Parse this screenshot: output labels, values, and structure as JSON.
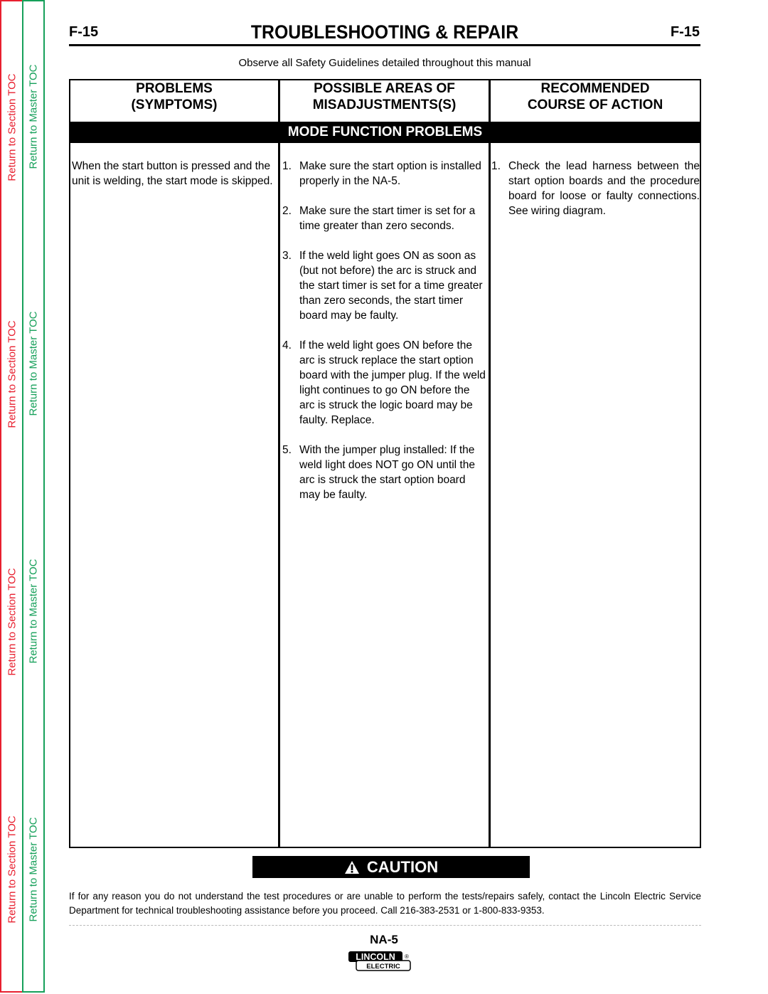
{
  "toc": {
    "section_label": "Return to Section TOC",
    "master_label": "Return to Master TOC",
    "section_color": "#e8202f",
    "master_color": "#16a05a"
  },
  "header": {
    "page_code_left": "F-15",
    "page_code_right": "F-15",
    "title": "TROUBLESHOOTING & REPAIR",
    "safety_note": "Observe all Safety Guidelines detailed throughout this manual"
  },
  "table": {
    "columns": [
      {
        "line1": "PROBLEMS",
        "line2": "(SYMPTOMS)"
      },
      {
        "line1": "POSSIBLE AREAS OF",
        "line2": "MISADJUSTMENTS(S)"
      },
      {
        "line1": "RECOMMENDED",
        "line2": "COURSE OF ACTION"
      }
    ],
    "section_band": "MODE FUNCTION PROBLEMS",
    "rows": [
      {
        "symptom": "When the start button is pressed and the unit is welding,  the start mode is skipped.",
        "misadjustments": [
          {
            "num": "1.",
            "text": "Make sure the start option is installed properly in the NA-5."
          },
          {
            "num": "2.",
            "text": "Make sure the start timer is set for a time greater than zero seconds."
          },
          {
            "num": "3.",
            "text": "If the weld light goes ON as soon as (but not before) the arc is struck and the start timer is set for a time greater than zero seconds, the start timer board may be faulty."
          },
          {
            "num": "4.",
            "text": "If the weld light goes ON before the arc is struck replace the start option board with the jumper plug.  If the weld light continues to go ON before the arc is struck the logic board may be faulty. Replace."
          },
          {
            "num": "5.",
            "text": "With the jumper plug installed: If the weld light does NOT go ON until the arc is struck the start option board may be faulty."
          }
        ],
        "actions": [
          {
            "num": "1.",
            "text": "Check the lead harness between the start option boards and the procedure board for loose or faulty connections.  See wiring diagram."
          }
        ]
      }
    ]
  },
  "caution": {
    "icon": "warning-triangle-icon",
    "label": "CAUTION",
    "notice": "If for any reason you do not understand the test procedures or are unable to perform the tests/repairs safely, contact the Lincoln Electric Service Department for technical troubleshooting assistance before you proceed. Call 216-383-2531 or 1-800-833-9353."
  },
  "footer": {
    "model": "NA-5",
    "logo_top": "LINCOLN",
    "logo_bottom": "ELECTRIC",
    "logo_mark": "®"
  }
}
